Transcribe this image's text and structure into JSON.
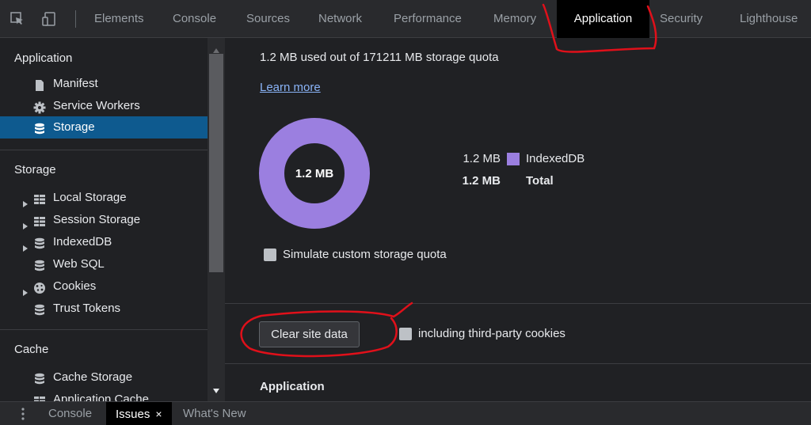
{
  "toolbar": {
    "tabs": [
      "Elements",
      "Console",
      "Sources",
      "Network",
      "Performance",
      "Memory",
      "Application",
      "Security",
      "Lighthouse"
    ],
    "active_tab": "Application"
  },
  "sidebar": {
    "application_heading": "Application",
    "application_items": [
      "Manifest",
      "Service Workers",
      "Storage"
    ],
    "selected_item": "Storage",
    "storage_heading": "Storage",
    "storage_items": [
      "Local Storage",
      "Session Storage",
      "IndexedDB",
      "Web SQL",
      "Cookies",
      "Trust Tokens"
    ],
    "cache_heading": "Cache",
    "cache_items": [
      "Cache Storage",
      "Application Cache"
    ]
  },
  "main": {
    "quota_text": "1.2 MB used out of 171211 MB storage quota",
    "learn_more": "Learn more",
    "donut_label": "1.2 MB",
    "legend": {
      "rows": [
        {
          "value": "1.2 MB",
          "name": "IndexedDB",
          "color": "#9b7fe0"
        },
        {
          "value": "1.2 MB",
          "name": "Total"
        }
      ]
    },
    "simulate_quota_label": "Simulate custom storage quota",
    "clear_button": "Clear site data",
    "third_party_label": "including third-party cookies",
    "section_heading": "Application"
  },
  "drawer": {
    "tabs": [
      "Console",
      "Issues",
      "What's New"
    ],
    "active_tab": "Issues",
    "close_glyph": "×"
  },
  "colors": {
    "accent_purple": "#9b7fe0",
    "selected_bg": "#0e5a8f",
    "link": "#8ab4f8",
    "annotation_red": "#e0101a"
  }
}
